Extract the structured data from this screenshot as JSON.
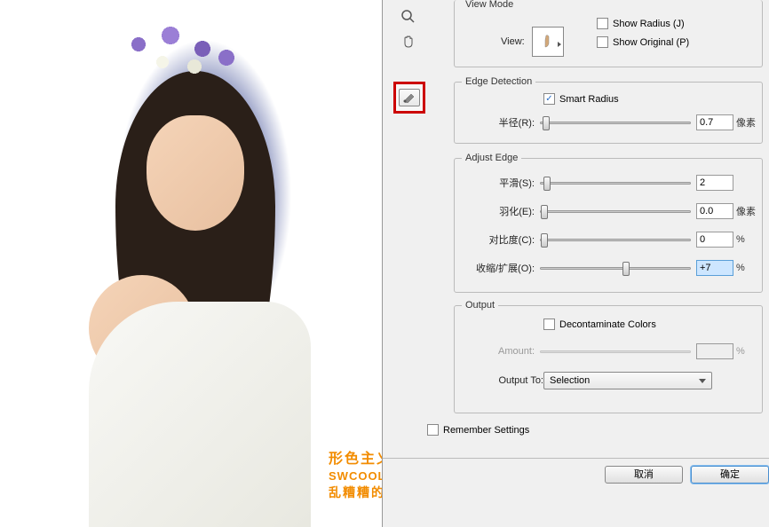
{
  "viewMode": {
    "title": "View Mode",
    "viewLabel": "View:",
    "showRadius": "Show Radius (J)",
    "showOriginal": "Show Original (P)",
    "showRadiusChecked": false,
    "showOriginalChecked": false
  },
  "edgeDetection": {
    "title": "Edge Detection",
    "smartRadius": "Smart Radius",
    "smartRadiusChecked": true,
    "radiusLabel": "半径(R):",
    "radiusValue": "0.7",
    "radiusUnit": "像素"
  },
  "adjustEdge": {
    "title": "Adjust Edge",
    "smoothLabel": "平滑(S):",
    "smoothValue": "2",
    "featherLabel": "羽化(E):",
    "featherValue": "0.0",
    "featherUnit": "像素",
    "contrastLabel": "对比度(C):",
    "contrastValue": "0",
    "contrastUnit": "%",
    "shiftLabel": "收缩/扩展(O):",
    "shiftValue": "+7",
    "shiftUnit": "%"
  },
  "output": {
    "title": "Output",
    "decontaminate": "Decontaminate Colors",
    "decontaminateChecked": false,
    "amountLabel": "Amount:",
    "amountUnit": "%",
    "outputToLabel": "Output To:",
    "outputToValue": "Selection"
  },
  "remember": {
    "label": "Remember Settings",
    "checked": false
  },
  "buttons": {
    "cancel": "取消",
    "ok": "确定"
  },
  "watermark": {
    "line1": "形色主义",
    "line2": "SWCOOL.COM",
    "line3": "乱糟糟的季节"
  },
  "icons": {
    "zoom": "zoom-icon",
    "hand": "hand-icon",
    "brush": "brush-icon"
  }
}
